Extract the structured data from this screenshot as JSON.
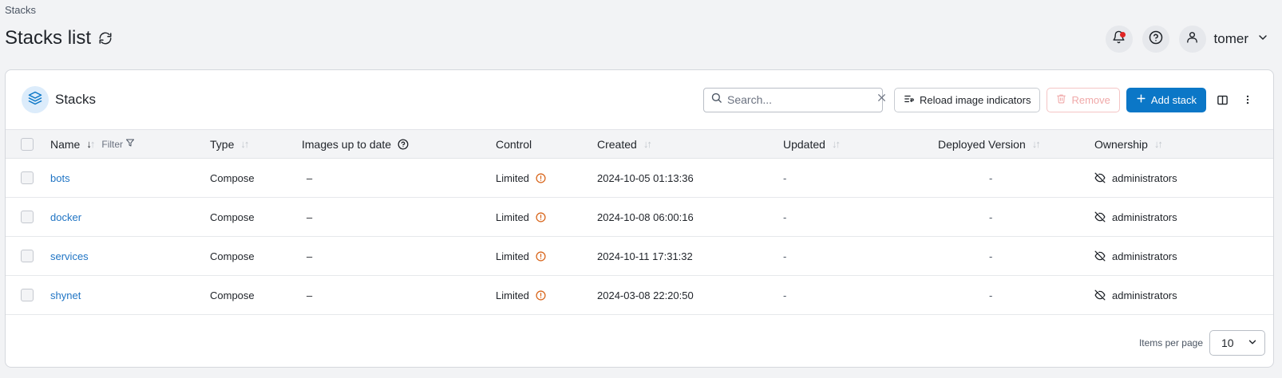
{
  "breadcrumb": "Stacks",
  "page_title": "Stacks list",
  "user": {
    "name": "tomer"
  },
  "card": {
    "title": "Stacks",
    "search_placeholder": "Search...",
    "reload_label": "Reload image indicators",
    "remove_label": "Remove",
    "add_label": "Add stack"
  },
  "columns": {
    "name": "Name",
    "filter": "Filter",
    "type": "Type",
    "images": "Images up to date",
    "control": "Control",
    "created": "Created",
    "updated": "Updated",
    "deployed": "Deployed Version",
    "ownership": "Ownership"
  },
  "rows": [
    {
      "name": "bots",
      "type": "Compose",
      "images": "–",
      "control": "Limited",
      "created": "2024-10-05 01:13:36",
      "updated": "-",
      "deployed": "-",
      "ownership": "administrators"
    },
    {
      "name": "docker",
      "type": "Compose",
      "images": "–",
      "control": "Limited",
      "created": "2024-10-08 06:00:16",
      "updated": "-",
      "deployed": "-",
      "ownership": "administrators"
    },
    {
      "name": "services",
      "type": "Compose",
      "images": "–",
      "control": "Limited",
      "created": "2024-10-11 17:31:32",
      "updated": "-",
      "deployed": "-",
      "ownership": "administrators"
    },
    {
      "name": "shynet",
      "type": "Compose",
      "images": "–",
      "control": "Limited",
      "created": "2024-03-08 22:20:50",
      "updated": "-",
      "deployed": "-",
      "ownership": "administrators"
    }
  ],
  "footer": {
    "items_per_page_label": "Items per page",
    "items_per_page_value": "10"
  },
  "colors": {
    "primary": "#0b77c7",
    "link": "#1f74c4",
    "warning": "#d9681f",
    "notification": "#e02424"
  }
}
